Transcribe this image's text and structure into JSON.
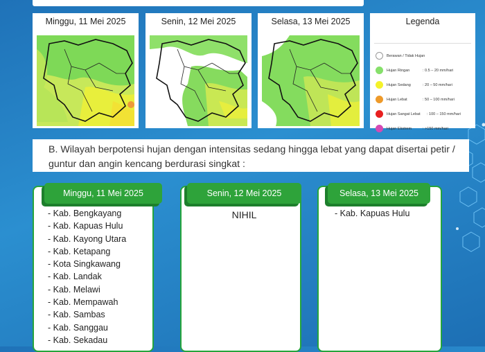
{
  "maps": [
    {
      "title": "Minggu, 11 Mei 2025"
    },
    {
      "title": "Senin, 12 Mei 2025"
    },
    {
      "title": "Selasa, 13 Mei 2025"
    }
  ],
  "legend": {
    "title": "Legenda",
    "items": [
      {
        "label": "Berawan / Tidak Hujan",
        "range": "",
        "color": "#ffffff"
      },
      {
        "label": "Hujan Ringan",
        "range": ": 0.5 – 20 mm/hari",
        "color": "#86e06b"
      },
      {
        "label": "Hujan Sedang",
        "range": ": 20 – 50 mm/hari",
        "color": "#f4f22a"
      },
      {
        "label": "Hujan Lebat",
        "range": ": 50 – 100 mm/hari",
        "color": "#ee9a2a"
      },
      {
        "label": "Hujan Sangat Lebat",
        "range": ": 100 – 150 mm/hari",
        "color": "#e82020"
      },
      {
        "label": "Hujan Ekstrem",
        "range": ": >150 mm/hari",
        "color": "#d44ab4"
      }
    ]
  },
  "section_b": {
    "text": "B. Wilayah berpotensi hujan dengan intensitas sedang hingga lebat yang dapat disertai petir / guntur dan angin kencang berdurasi singkat :"
  },
  "regions": [
    {
      "day": "Minggu, 11 Mei 2025",
      "items": [
        "- Kab. Bengkayang",
        "- Kab. Kapuas Hulu",
        "- Kab. Kayong Utara",
        "- Kab. Ketapang",
        "- Kota Singkawang",
        "- Kab. Landak",
        "- Kab. Melawi",
        "- Kab. Mempawah",
        "- Kab. Sambas",
        "- Kab. Sanggau",
        "- Kab. Sekadau"
      ]
    },
    {
      "day": "Senin, 12 Mei 2025",
      "nihil": "NIHIL",
      "items": []
    },
    {
      "day": "Selasa, 13 Mei 2025",
      "items": [
        "- Kab. Kapuas Hulu"
      ]
    }
  ]
}
